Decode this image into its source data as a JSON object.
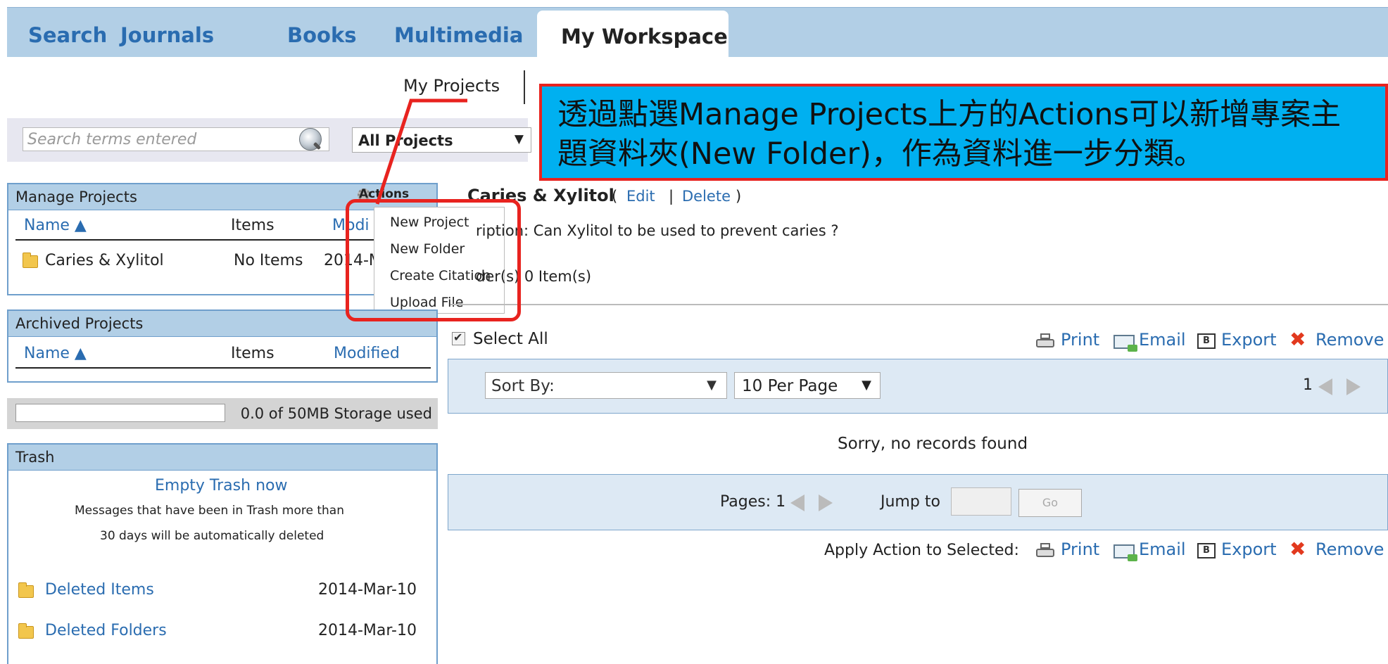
{
  "top_tabs": [
    {
      "label": "Search"
    },
    {
      "label": "Journals"
    },
    {
      "label": "Books"
    },
    {
      "label": "Multimedia"
    },
    {
      "label": "My Workspace",
      "active": true
    }
  ],
  "subnav": {
    "my_projects": "My Projects"
  },
  "search": {
    "placeholder": "Search terms entered",
    "scope": "All Projects"
  },
  "manage_projects": {
    "title": "Manage Projects",
    "actions_label": "Actions",
    "col_name": "Name ▲",
    "col_items": "Items",
    "col_modified": "Modi",
    "rows": [
      {
        "name": "Caries & Xylitol",
        "items": "No Items",
        "modified": "2014-M"
      }
    ]
  },
  "actions_menu": [
    "New Project",
    "New Folder",
    "Create Citation",
    "Upload File"
  ],
  "archived_projects": {
    "title": "Archived Projects",
    "col_name": "Name ▲",
    "col_items": "Items",
    "col_modified": "Modified"
  },
  "storage": {
    "text": "0.0 of 50MB Storage used",
    "used_fraction": 0.0
  },
  "trash": {
    "title": "Trash",
    "empty_link": "Empty Trash now",
    "message_line1": "Messages that have been in Trash more than",
    "message_line2": "30 days will be automatically deleted",
    "items": [
      {
        "name": "Deleted Items",
        "date": "2014-Mar-10"
      },
      {
        "name": "Deleted Folders",
        "date": "2014-Mar-10"
      }
    ]
  },
  "project": {
    "title": "Caries & Xylitol",
    "paren_open": "(",
    "edit": "Edit",
    "sep": "|",
    "delete": "Delete",
    "paren_close": ")",
    "description": "ription: Can Xylitol to be used to prevent caries ?",
    "folder_count": "der(s) 0 Item(s)"
  },
  "toolbar": {
    "select_all": "Select All",
    "print": "Print",
    "email": "Email",
    "export": "Export",
    "remove": "Remove"
  },
  "sort": {
    "sort_by": "Sort By:",
    "per_page": "10 Per Page",
    "page": "1"
  },
  "results": {
    "empty": "Sorry, no records found"
  },
  "pager": {
    "pages_label": "Pages: 1",
    "jump_label": "Jump to",
    "go": "Go"
  },
  "apply": {
    "label": "Apply Action to Selected:"
  },
  "callout": {
    "line1": "透過點選Manage Projects上方的Actions可以新增專案主",
    "line2": "題資料夾(New Folder)，作為資料進一步分類。"
  },
  "colors": {
    "accent": "#2a6cb0",
    "header_bg": "#b2cfe6",
    "callout_bg": "#00b0f0",
    "callout_border": "#e8231f",
    "remove": "#e2391e"
  },
  "icons": [
    "search-icon",
    "dropdown-arrow-icon",
    "gear-icon",
    "folder-icon",
    "checkbox-icon",
    "printer-icon",
    "email-icon",
    "export-icon",
    "remove-icon",
    "prev-page-icon",
    "next-page-icon"
  ]
}
